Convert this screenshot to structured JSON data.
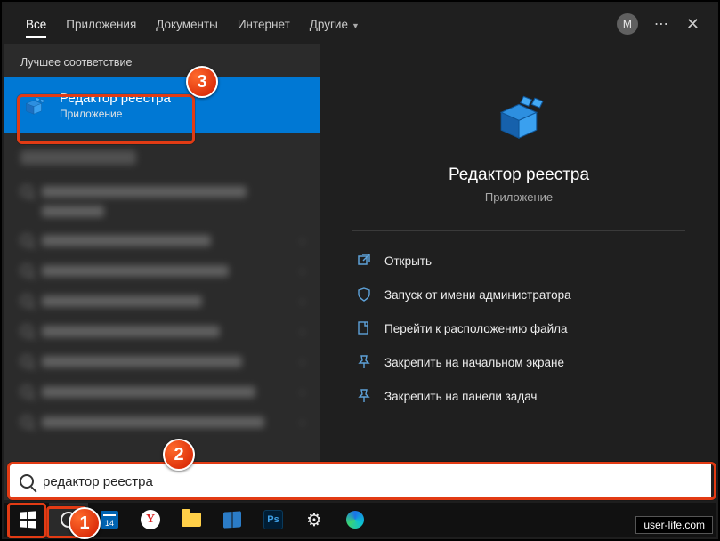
{
  "tabs": {
    "all": "Все",
    "apps": "Приложения",
    "docs": "Документы",
    "internet": "Интернет",
    "more": "Другие"
  },
  "avatar_letter": "M",
  "section_best_match": "Лучшее соответствие",
  "top_result": {
    "title": "Редактор реестра",
    "subtitle": "Приложение"
  },
  "preview": {
    "title": "Редактор реестра",
    "subtitle": "Приложение"
  },
  "actions": {
    "open": "Открыть",
    "run_as_admin": "Запуск от имени администратора",
    "open_file_location": "Перейти к расположению файла",
    "pin_start": "Закрепить на начальном экране",
    "pin_taskbar": "Закрепить на панели задач"
  },
  "search_query": "редактор реестра",
  "annotations": {
    "1": "1",
    "2": "2",
    "3": "3"
  },
  "watermark": "user-life.com"
}
